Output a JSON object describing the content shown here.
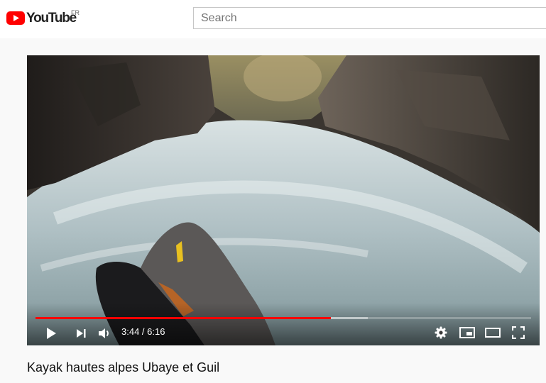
{
  "masthead": {
    "logo_text": "YouTube",
    "region": "FR",
    "logo_color": "#ff0000",
    "search": {
      "placeholder": "Search",
      "value": ""
    }
  },
  "player": {
    "current_time": "3:44",
    "duration": "6:16",
    "time_display": "3:44 / 6:16",
    "played_fraction": 0.596,
    "buffered_fraction": 0.67,
    "progress_color": "#ff0000",
    "icons": {
      "play": "play-icon",
      "next": "next-icon",
      "volume": "volume-icon",
      "settings": "gear-icon",
      "miniplayer": "miniplayer-icon",
      "theater": "theater-mode-icon",
      "fullscreen": "fullscreen-icon"
    }
  },
  "video": {
    "title": "Kayak hautes alpes Ubaye et Guil"
  }
}
